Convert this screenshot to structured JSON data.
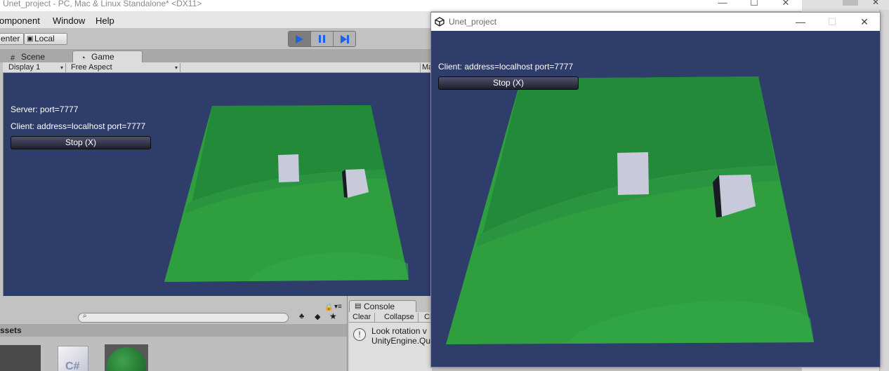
{
  "editor": {
    "title": "Unet_project - PC, Mac & Linux Standalone* <DX11>",
    "menu": [
      "Component",
      "Window",
      "Help"
    ],
    "menu_partial_first": "omponent",
    "toolbar": {
      "pivot_label": "enter",
      "local_label": "Local"
    },
    "tabs": {
      "scene": "Scene",
      "game": "Game"
    },
    "game_bar": {
      "display": "Display 1",
      "aspect": "Free Aspect",
      "maximize_partial": "Ma"
    },
    "game_view": {
      "server_label": "Server: port=7777",
      "client_label": "Client: address=localhost port=7777",
      "stop_button": "Stop (X)"
    },
    "project": {
      "header_partial": "ssets"
    },
    "console": {
      "tab": "Console",
      "buttons": {
        "clear": "Clear",
        "collapse": "Collapse",
        "clear_on_play_partial": "Cl"
      },
      "message_line1": "Look rotation v",
      "message_line2": "UnityEngine.Qu"
    }
  },
  "player": {
    "title": "Unet_project",
    "client_label": "Client: address=localhost port=7777",
    "stop_button": "Stop (X)"
  },
  "colors": {
    "sky": "#2f3d6b",
    "ground": "#2f9e3e",
    "ground_dark": "#238a3a",
    "cube": "#c9c9dc",
    "play_accent": "#1d62e8"
  }
}
